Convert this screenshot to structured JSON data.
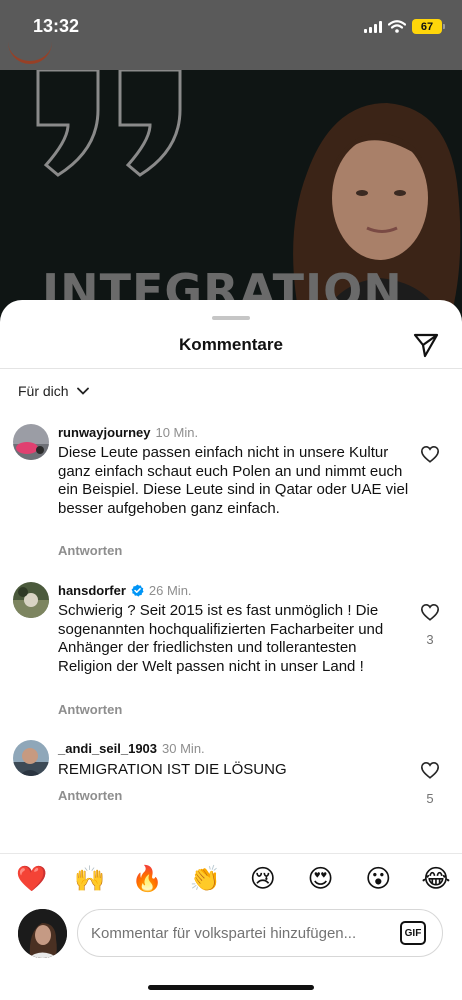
{
  "status_bar": {
    "time": "13:32",
    "battery": "67"
  },
  "post_background": {
    "headline": "INTEGRATION"
  },
  "sheet": {
    "title": "Kommentare",
    "filter_label": "Für dich"
  },
  "comments": [
    {
      "username": "runwayjourney",
      "time": "10 Min.",
      "verified": false,
      "text": "Diese Leute passen einfach nicht in unsere Kultur ganz einfach schaut euch Polen an und nimmt euch ein Beispiel. Diese Leute sind in Qatar oder UAE viel besser aufgehoben ganz einfach.",
      "reply_label": "Antworten",
      "likes": ""
    },
    {
      "username": "hansdorfer",
      "time": "26 Min.",
      "verified": true,
      "text": "Schwierig ? Seit 2015 ist es fast unmöglich ! Die sogenannten hochqualifizierten Facharbeiter und Anhänger der friedlichsten und tollerantesten Religion der Welt passen nicht in unser Land !",
      "reply_label": "Antworten",
      "likes": "3"
    },
    {
      "username": "_andi_seil_1903",
      "time": "30 Min.",
      "verified": false,
      "text": "REMIGRATION IST DIE LÖSUNG",
      "reply_label": "Antworten",
      "likes": "5"
    }
  ],
  "emoji_bar": [
    "❤️",
    "🙌",
    "🔥",
    "👏",
    "😢",
    "😍",
    "😮",
    "😂"
  ],
  "composer": {
    "placeholder": "Kommentar für volkspartei hinzufügen...",
    "gif_label": "GIF"
  },
  "colors": {
    "like_accent": "#262626",
    "muted": "#8e8e8e",
    "verified": "#0095f6",
    "battery": "#ffd60a"
  }
}
